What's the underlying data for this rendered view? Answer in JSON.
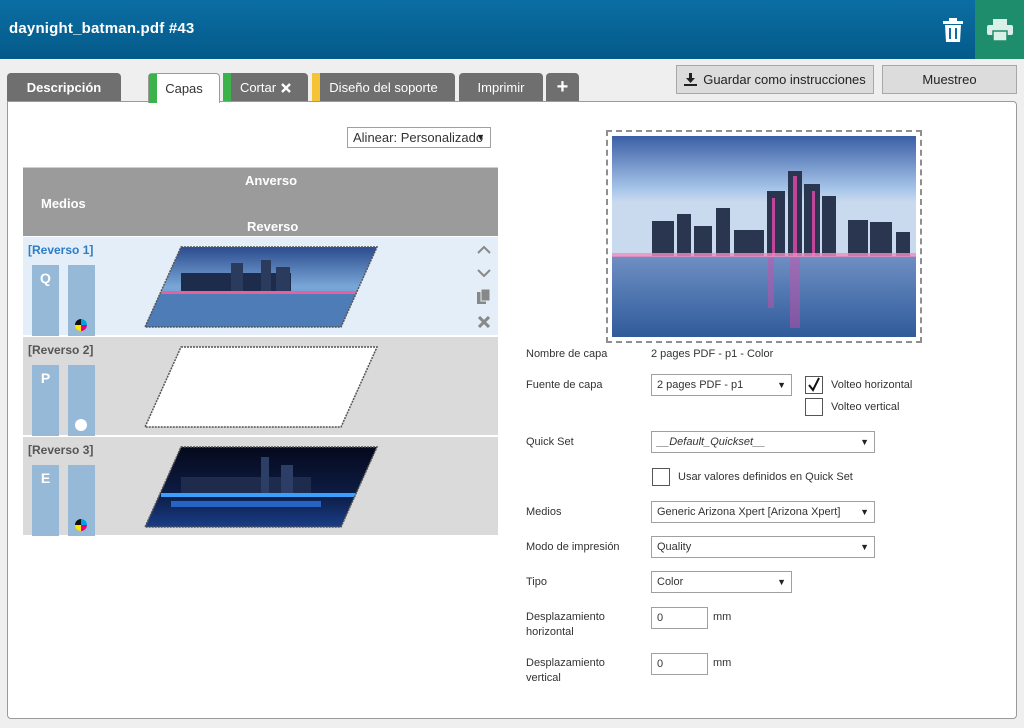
{
  "window": {
    "title": "daynight_batman.pdf #43"
  },
  "header": {
    "trash_icon": "trash-icon",
    "print_icon": "printer-icon"
  },
  "tabs": [
    {
      "label": "Descripción",
      "color": ""
    },
    {
      "label": "Capas",
      "color": "#3cb34a"
    },
    {
      "label": "Cortar",
      "color": "#3cb34a"
    },
    {
      "label": "Diseño del soporte",
      "color": "#f5c333"
    },
    {
      "label": "Imprimir",
      "color": ""
    },
    {
      "label": "+",
      "color": ""
    }
  ],
  "actions": {
    "save_label": "Guardar como instrucciones",
    "muestreo_label": "Muestreo"
  },
  "layers_panel": {
    "align_select": "Alinear: Personalizado",
    "header": {
      "medios": "Medios",
      "anverso": "Anverso",
      "reverso": "Reverso"
    },
    "layers": [
      {
        "name": "[Reverso 1]",
        "letter": "Q",
        "ink": "cmyk",
        "selected": true
      },
      {
        "name": "[Reverso 2]",
        "letter": "P",
        "ink": "white",
        "selected": false
      },
      {
        "name": "[Reverso 3]",
        "letter": "E",
        "ink": "cmyk",
        "selected": false
      }
    ]
  },
  "form": {
    "layer_name_label": "Nombre de capa",
    "layer_name_value": "2 pages PDF - p1 - Color",
    "layer_source_label": "Fuente de capa",
    "layer_source_value": "2 pages PDF - p1",
    "flip_horizontal_label": "Volteo horizontal",
    "flip_horizontal_checked": true,
    "flip_vertical_label": "Volteo vertical",
    "flip_vertical_checked": false,
    "quickset_label": "Quick Set",
    "quickset_value": "__Default_Quickset__",
    "use_quickset_label": "Usar valores definidos en Quick Set",
    "use_quickset_checked": false,
    "media_label": "Medios",
    "media_value": "Generic Arizona Xpert [Arizona Xpert]",
    "print_mode_label": "Modo de impresión",
    "print_mode_value": "Quality",
    "type_label": "Tipo",
    "type_value": "Color",
    "offset_h_label_1": "Desplazamiento",
    "offset_h_label_2": "horizontal",
    "offset_h_value": "0",
    "offset_v_label_1": "Desplazamiento",
    "offset_v_label_2": "vertical",
    "offset_v_value": "0",
    "unit": "mm"
  },
  "icons": {
    "move_up": "chevron-up-icon",
    "move_down": "chevron-down-icon",
    "copy": "copy-icon",
    "delete": "close-icon",
    "download": "download-icon",
    "caret": "caret-down-icon",
    "checkmark": "checkmark-icon"
  }
}
